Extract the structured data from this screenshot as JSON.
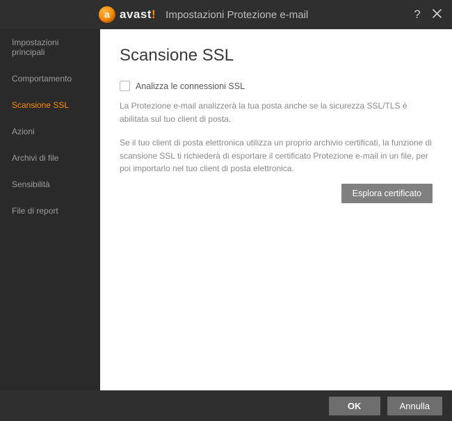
{
  "titlebar": {
    "brand_prefix": "avast",
    "brand_bang": "!",
    "window_title": "Impostazioni Protezione e-mail"
  },
  "sidebar": {
    "items": [
      {
        "label": "Impostazioni principali",
        "active": false
      },
      {
        "label": "Comportamento",
        "active": false
      },
      {
        "label": "Scansione SSL",
        "active": true
      },
      {
        "label": "Azioni",
        "active": false
      },
      {
        "label": "Archivi di file",
        "active": false
      },
      {
        "label": "Sensibilità",
        "active": false
      },
      {
        "label": "File di report",
        "active": false
      }
    ]
  },
  "main": {
    "heading": "Scansione SSL",
    "checkbox_label": "Analizza le connessioni SSL",
    "checkbox_checked": false,
    "desc1": "La Protezione e-mail analizzerà la tua posta anche se la sicurezza SSL/TLS è abilitata sul tuo client di posta.",
    "desc2": "Se il tuo client di posta elettronica utilizza un proprio archivio certificati, la funzione di scansione SSL ti richiederà di esportare il certificato Protezione e-mail in un file, per poi importarlo nel tuo client di posta elettronica.",
    "explore_btn": "Esplora certificato"
  },
  "footer": {
    "ok": "OK",
    "cancel": "Annulla"
  }
}
